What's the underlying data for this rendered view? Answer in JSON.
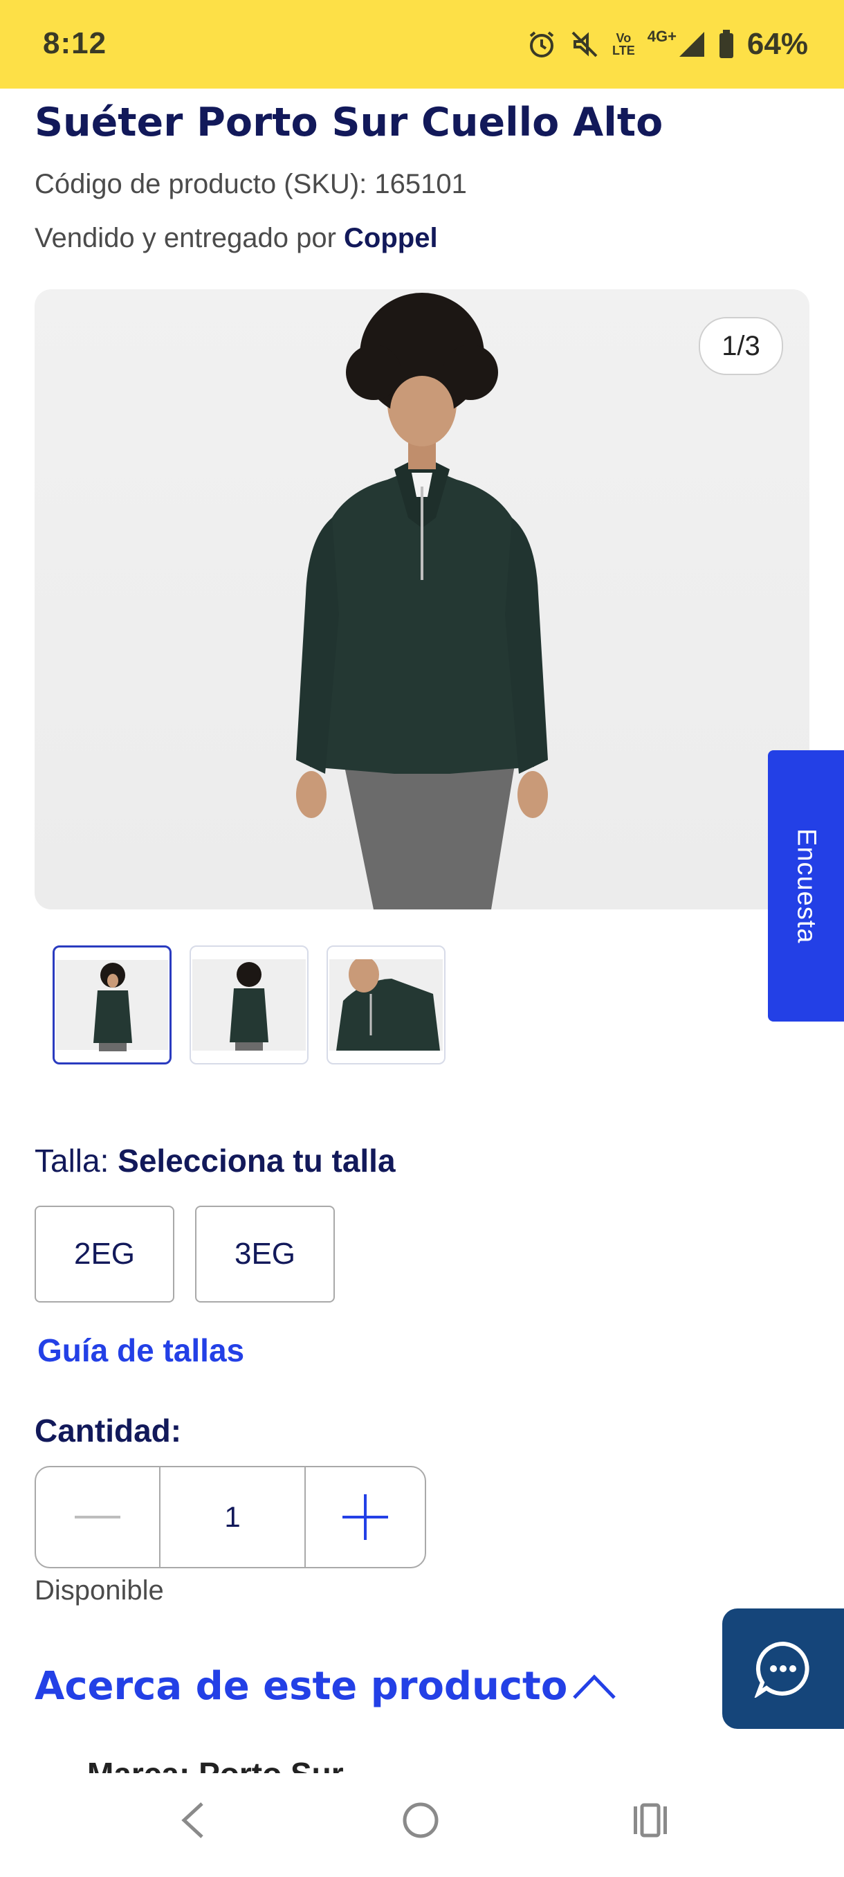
{
  "status_bar": {
    "time": "8:12",
    "network_top": "Vo",
    "network_bottom": "LTE",
    "network_type": "4G+",
    "battery": "64%",
    "icons": [
      "alarm-icon",
      "mute-icon",
      "signal-icon",
      "battery-icon"
    ]
  },
  "product": {
    "title": "Suéter Porto Sur Cuello Alto",
    "sku_text": "Código de producto (SKU): 165101",
    "sold_by_prefix": "Vendido y entregado por",
    "seller": "Coppel",
    "image_counter": "1/3",
    "thumbnail_count": 3
  },
  "survey": {
    "label": "Encuesta"
  },
  "size": {
    "label": "Talla:",
    "prompt": "Selecciona tu talla",
    "options": [
      "2EG",
      "3EG"
    ],
    "guide_link": "Guía de tallas"
  },
  "quantity": {
    "label": "Cantidad:",
    "value": "1",
    "availability": "Disponible"
  },
  "about": {
    "title": "Acerca de este producto",
    "cut_off_line": "Marca: Porto Sur"
  },
  "colors": {
    "status_bar": "#fde047",
    "primary_blue": "#2340e6",
    "navy": "#12195a",
    "chat": "#15457a"
  },
  "nav": {
    "icons": [
      "back-icon",
      "home-icon",
      "recents-icon"
    ]
  }
}
